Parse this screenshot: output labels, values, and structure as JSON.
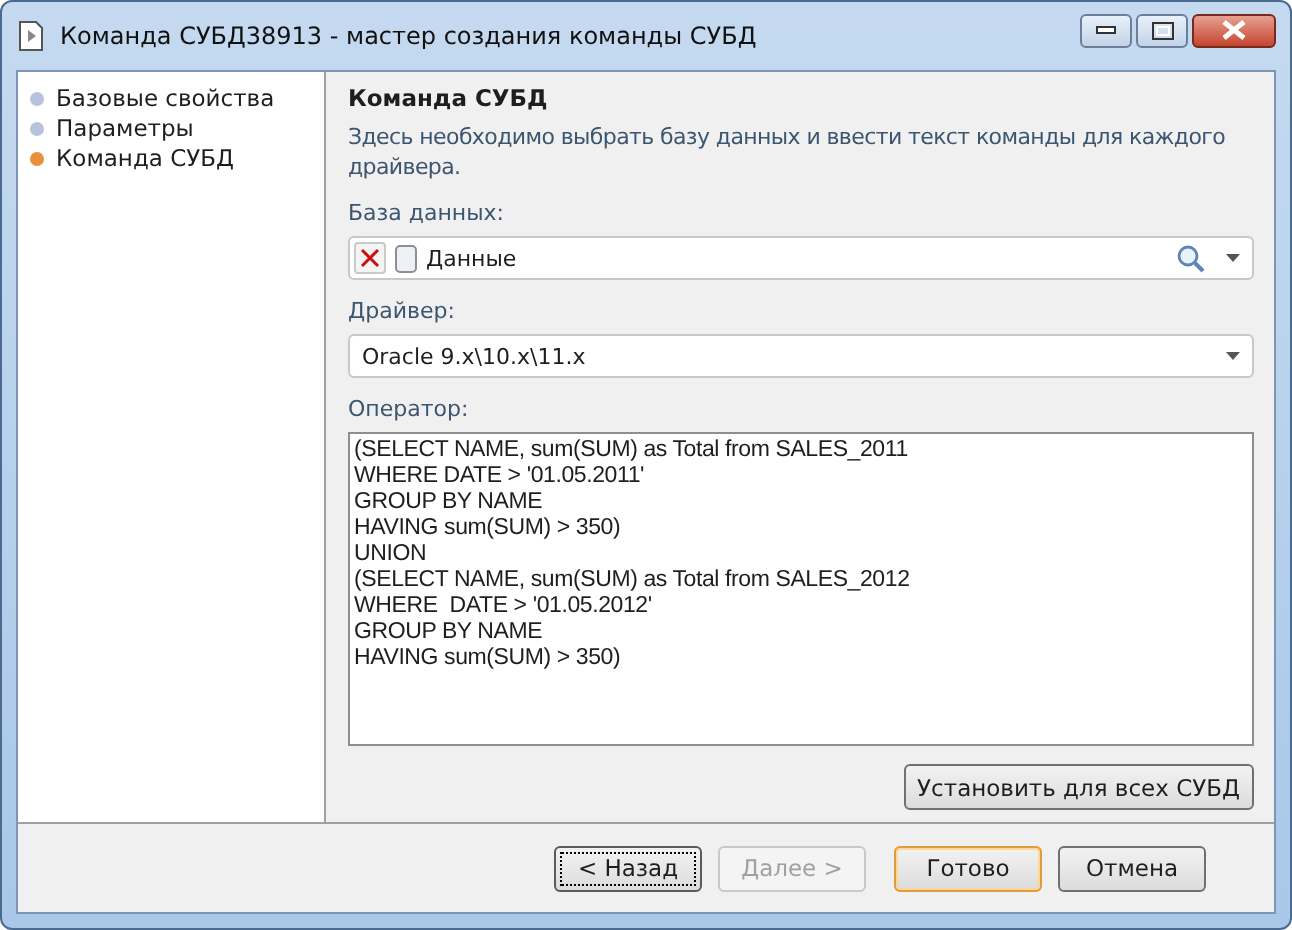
{
  "window": {
    "title": "Команда СУБД38913 - мастер создания команды СУБД"
  },
  "steps": [
    {
      "label": "Базовые свойства",
      "selected": false
    },
    {
      "label": "Параметры",
      "selected": false
    },
    {
      "label": "Команда СУБД",
      "selected": true
    }
  ],
  "page": {
    "title": "Команда СУБД",
    "description": "Здесь необходимо выбрать базу данных и ввести текст команды для каждого драйвера."
  },
  "database": {
    "label": "База данных:",
    "value": "Данные"
  },
  "driver": {
    "label": "Драйвер:",
    "value": "Oracle 9.x\\10.x\\11.x"
  },
  "operator": {
    "label": "Оператор:",
    "lines": [
      "(SELECT NAME, sum(SUM) as Total from SALES_2011",
      "WHERE DATE > '01.05.2011'",
      "GROUP BY NAME",
      "HAVING sum(SUM) > 350)",
      "UNION",
      "(SELECT NAME, sum(SUM) as Total from SALES_2012",
      "WHERE  DATE > '01.05.2012'",
      "GROUP BY NAME",
      "HAVING sum(SUM) > 350)"
    ]
  },
  "apply_all_button": "Установить для всех СУБД",
  "buttons": [
    {
      "label": "< Назад",
      "disabled": false,
      "focused": true,
      "default": false
    },
    {
      "label": "Далее >",
      "disabled": true,
      "focused": false,
      "default": false
    },
    {
      "label": "Готово",
      "disabled": false,
      "focused": false,
      "default": true
    },
    {
      "label": "Отмена",
      "disabled": false,
      "focused": false,
      "default": false
    }
  ]
}
